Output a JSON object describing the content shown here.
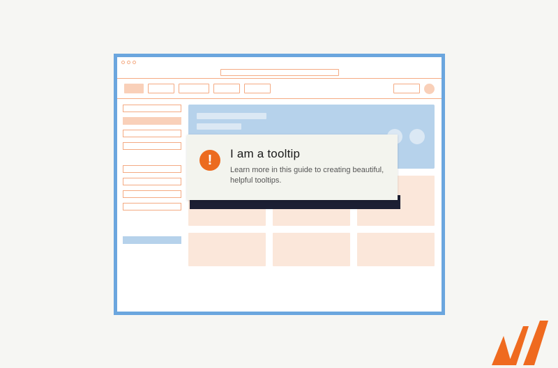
{
  "tooltip": {
    "title": "I am a tooltip",
    "description": "Learn more in this  guide to creating beautiful, helpful tooltips.",
    "icon_glyph": "!"
  }
}
